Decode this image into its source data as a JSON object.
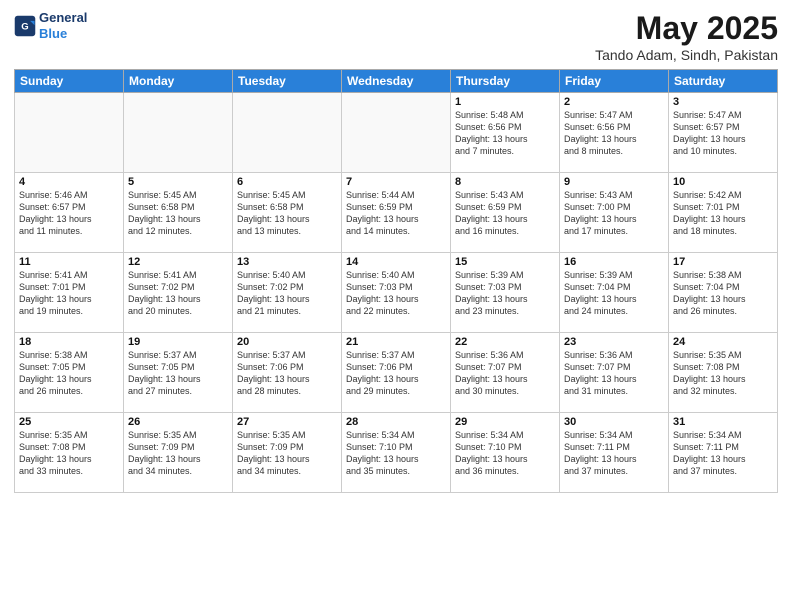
{
  "logo": {
    "line1": "General",
    "line2": "Blue"
  },
  "title": "May 2025",
  "subtitle": "Tando Adam, Sindh, Pakistan",
  "weekdays": [
    "Sunday",
    "Monday",
    "Tuesday",
    "Wednesday",
    "Thursday",
    "Friday",
    "Saturday"
  ],
  "weeks": [
    [
      {
        "day": "",
        "info": ""
      },
      {
        "day": "",
        "info": ""
      },
      {
        "day": "",
        "info": ""
      },
      {
        "day": "",
        "info": ""
      },
      {
        "day": "1",
        "info": "Sunrise: 5:48 AM\nSunset: 6:56 PM\nDaylight: 13 hours\nand 7 minutes."
      },
      {
        "day": "2",
        "info": "Sunrise: 5:47 AM\nSunset: 6:56 PM\nDaylight: 13 hours\nand 8 minutes."
      },
      {
        "day": "3",
        "info": "Sunrise: 5:47 AM\nSunset: 6:57 PM\nDaylight: 13 hours\nand 10 minutes."
      }
    ],
    [
      {
        "day": "4",
        "info": "Sunrise: 5:46 AM\nSunset: 6:57 PM\nDaylight: 13 hours\nand 11 minutes."
      },
      {
        "day": "5",
        "info": "Sunrise: 5:45 AM\nSunset: 6:58 PM\nDaylight: 13 hours\nand 12 minutes."
      },
      {
        "day": "6",
        "info": "Sunrise: 5:45 AM\nSunset: 6:58 PM\nDaylight: 13 hours\nand 13 minutes."
      },
      {
        "day": "7",
        "info": "Sunrise: 5:44 AM\nSunset: 6:59 PM\nDaylight: 13 hours\nand 14 minutes."
      },
      {
        "day": "8",
        "info": "Sunrise: 5:43 AM\nSunset: 6:59 PM\nDaylight: 13 hours\nand 16 minutes."
      },
      {
        "day": "9",
        "info": "Sunrise: 5:43 AM\nSunset: 7:00 PM\nDaylight: 13 hours\nand 17 minutes."
      },
      {
        "day": "10",
        "info": "Sunrise: 5:42 AM\nSunset: 7:01 PM\nDaylight: 13 hours\nand 18 minutes."
      }
    ],
    [
      {
        "day": "11",
        "info": "Sunrise: 5:41 AM\nSunset: 7:01 PM\nDaylight: 13 hours\nand 19 minutes."
      },
      {
        "day": "12",
        "info": "Sunrise: 5:41 AM\nSunset: 7:02 PM\nDaylight: 13 hours\nand 20 minutes."
      },
      {
        "day": "13",
        "info": "Sunrise: 5:40 AM\nSunset: 7:02 PM\nDaylight: 13 hours\nand 21 minutes."
      },
      {
        "day": "14",
        "info": "Sunrise: 5:40 AM\nSunset: 7:03 PM\nDaylight: 13 hours\nand 22 minutes."
      },
      {
        "day": "15",
        "info": "Sunrise: 5:39 AM\nSunset: 7:03 PM\nDaylight: 13 hours\nand 23 minutes."
      },
      {
        "day": "16",
        "info": "Sunrise: 5:39 AM\nSunset: 7:04 PM\nDaylight: 13 hours\nand 24 minutes."
      },
      {
        "day": "17",
        "info": "Sunrise: 5:38 AM\nSunset: 7:04 PM\nDaylight: 13 hours\nand 26 minutes."
      }
    ],
    [
      {
        "day": "18",
        "info": "Sunrise: 5:38 AM\nSunset: 7:05 PM\nDaylight: 13 hours\nand 26 minutes."
      },
      {
        "day": "19",
        "info": "Sunrise: 5:37 AM\nSunset: 7:05 PM\nDaylight: 13 hours\nand 27 minutes."
      },
      {
        "day": "20",
        "info": "Sunrise: 5:37 AM\nSunset: 7:06 PM\nDaylight: 13 hours\nand 28 minutes."
      },
      {
        "day": "21",
        "info": "Sunrise: 5:37 AM\nSunset: 7:06 PM\nDaylight: 13 hours\nand 29 minutes."
      },
      {
        "day": "22",
        "info": "Sunrise: 5:36 AM\nSunset: 7:07 PM\nDaylight: 13 hours\nand 30 minutes."
      },
      {
        "day": "23",
        "info": "Sunrise: 5:36 AM\nSunset: 7:07 PM\nDaylight: 13 hours\nand 31 minutes."
      },
      {
        "day": "24",
        "info": "Sunrise: 5:35 AM\nSunset: 7:08 PM\nDaylight: 13 hours\nand 32 minutes."
      }
    ],
    [
      {
        "day": "25",
        "info": "Sunrise: 5:35 AM\nSunset: 7:08 PM\nDaylight: 13 hours\nand 33 minutes."
      },
      {
        "day": "26",
        "info": "Sunrise: 5:35 AM\nSunset: 7:09 PM\nDaylight: 13 hours\nand 34 minutes."
      },
      {
        "day": "27",
        "info": "Sunrise: 5:35 AM\nSunset: 7:09 PM\nDaylight: 13 hours\nand 34 minutes."
      },
      {
        "day": "28",
        "info": "Sunrise: 5:34 AM\nSunset: 7:10 PM\nDaylight: 13 hours\nand 35 minutes."
      },
      {
        "day": "29",
        "info": "Sunrise: 5:34 AM\nSunset: 7:10 PM\nDaylight: 13 hours\nand 36 minutes."
      },
      {
        "day": "30",
        "info": "Sunrise: 5:34 AM\nSunset: 7:11 PM\nDaylight: 13 hours\nand 37 minutes."
      },
      {
        "day": "31",
        "info": "Sunrise: 5:34 AM\nSunset: 7:11 PM\nDaylight: 13 hours\nand 37 minutes."
      }
    ]
  ]
}
